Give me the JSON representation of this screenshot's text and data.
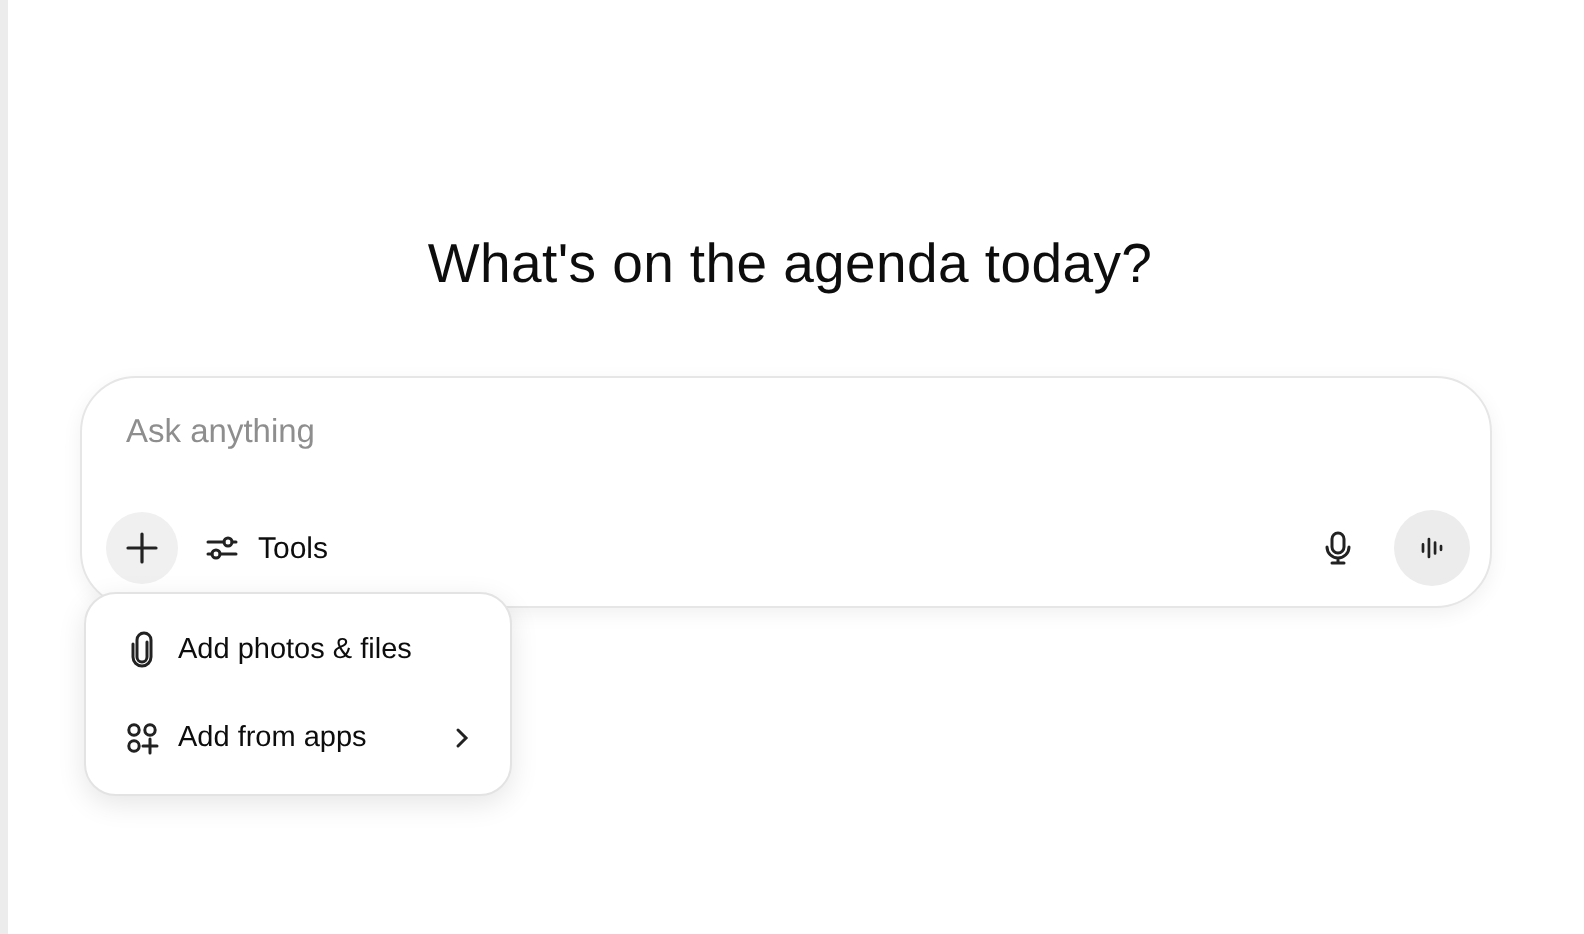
{
  "heading": "What's on the agenda today?",
  "composer": {
    "placeholder": "Ask anything",
    "tools_label": "Tools"
  },
  "attach_menu": {
    "items": [
      {
        "kind": "attach",
        "label": "Add photos & files",
        "has_submenu": false
      },
      {
        "kind": "apps",
        "label": "Add from apps",
        "has_submenu": true
      }
    ]
  }
}
